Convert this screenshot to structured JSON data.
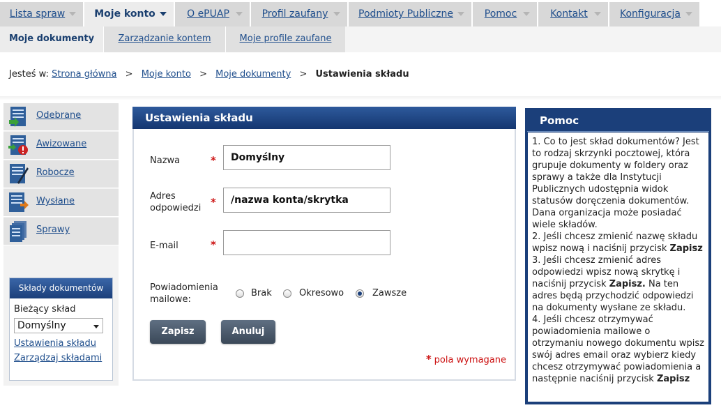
{
  "top_menu": [
    {
      "label": "Lista spraw",
      "active": false
    },
    {
      "label": "Moje konto",
      "active": true
    },
    {
      "label": "O ePUAP",
      "active": false
    },
    {
      "label": "Profil zaufany",
      "active": false
    },
    {
      "label": "Podmioty Publiczne",
      "active": false
    },
    {
      "label": "Pomoc",
      "active": false
    },
    {
      "label": "Kontakt",
      "active": false
    },
    {
      "label": "Konfiguracja",
      "active": false
    }
  ],
  "sub_menu": [
    {
      "label": "Moje dokumenty",
      "active": true
    },
    {
      "label": "Zarządzanie kontem",
      "active": false
    },
    {
      "label": "Moje profile zaufane",
      "active": false
    }
  ],
  "breadcrumb": {
    "prefix": "Jesteś w:",
    "links": [
      "Strona główna",
      "Moje konto",
      "Moje dokumenty"
    ],
    "separator": ">",
    "current": "Ustawienia składu"
  },
  "left_nav": [
    {
      "label": "Odebrane",
      "icon": "inbox-document-icon"
    },
    {
      "label": "Awizowane",
      "icon": "notice-document-icon"
    },
    {
      "label": "Robocze",
      "icon": "draft-document-icon"
    },
    {
      "label": "Wysłane",
      "icon": "sent-document-icon"
    },
    {
      "label": "Sprawy",
      "icon": "cases-document-icon"
    }
  ],
  "sklady_box": {
    "title": "Składy dokumentów",
    "current_label": "Bieżący skład",
    "selected": "Domyślny",
    "link_settings": "Ustawienia składu",
    "link_manage": "Zarządzaj składami"
  },
  "form": {
    "title": "Ustawienia składu",
    "name_label": "Nazwa",
    "name_value": "Domyślny",
    "reply_label_1": "Adres",
    "reply_label_2": "odpowiedzi",
    "reply_value": "/nazwa konta/skrytka",
    "email_label": "E-mail",
    "email_value": "",
    "notify_label_1": "Powiadomienia",
    "notify_label_2": "mailowe:",
    "notify_options": [
      "Brak",
      "Okresowo",
      "Zawsze"
    ],
    "notify_selected": "Zawsze",
    "required_star": "*",
    "save_label": "Zapisz",
    "cancel_label": "Anuluj",
    "required_note": "pola wymagane"
  },
  "help": {
    "title": "Pomoc",
    "p1": "1. Co to jest skład dokumentów? Jest to rodzaj skrzynki pocztowej, która grupuje dokumenty w foldery oraz sprawy a także dla Instytucji Publicznych udostępnia widok statusów doręczenia dokumentów. Dana organizacja może posiadać wiele składów.",
    "p2_text": "2. Jeśli chcesz zmienić nazwę składu wpisz nową i naciśnij przycisk ",
    "p2_bold": "Zapisz",
    "p3_text": "3. Jeśli chcesz zmienić adres odpowiedzi wpisz nową skrytkę i naciśnij przycisk ",
    "p3_bold": "Zapisz.",
    "p3_rest": " Na ten adres będą przychodzić odpowiedzi na dokumenty wysłane ze składu.",
    "p4_text": "4. Jeśli chcesz otrzymywać powiadomienia mailowe o otrzymaniu nowego dokumentu wpisz swój adres email oraz wybierz kiedy chcesz otrzymywać powiadomienia a następnie naciśnij przycisk ",
    "p4_bold": "Zapisz"
  },
  "colors": {
    "header_blue": "#1b3f7a",
    "link_blue": "#1f4e8c",
    "required_red": "#cc1111",
    "button_gray": "#4a5868"
  }
}
